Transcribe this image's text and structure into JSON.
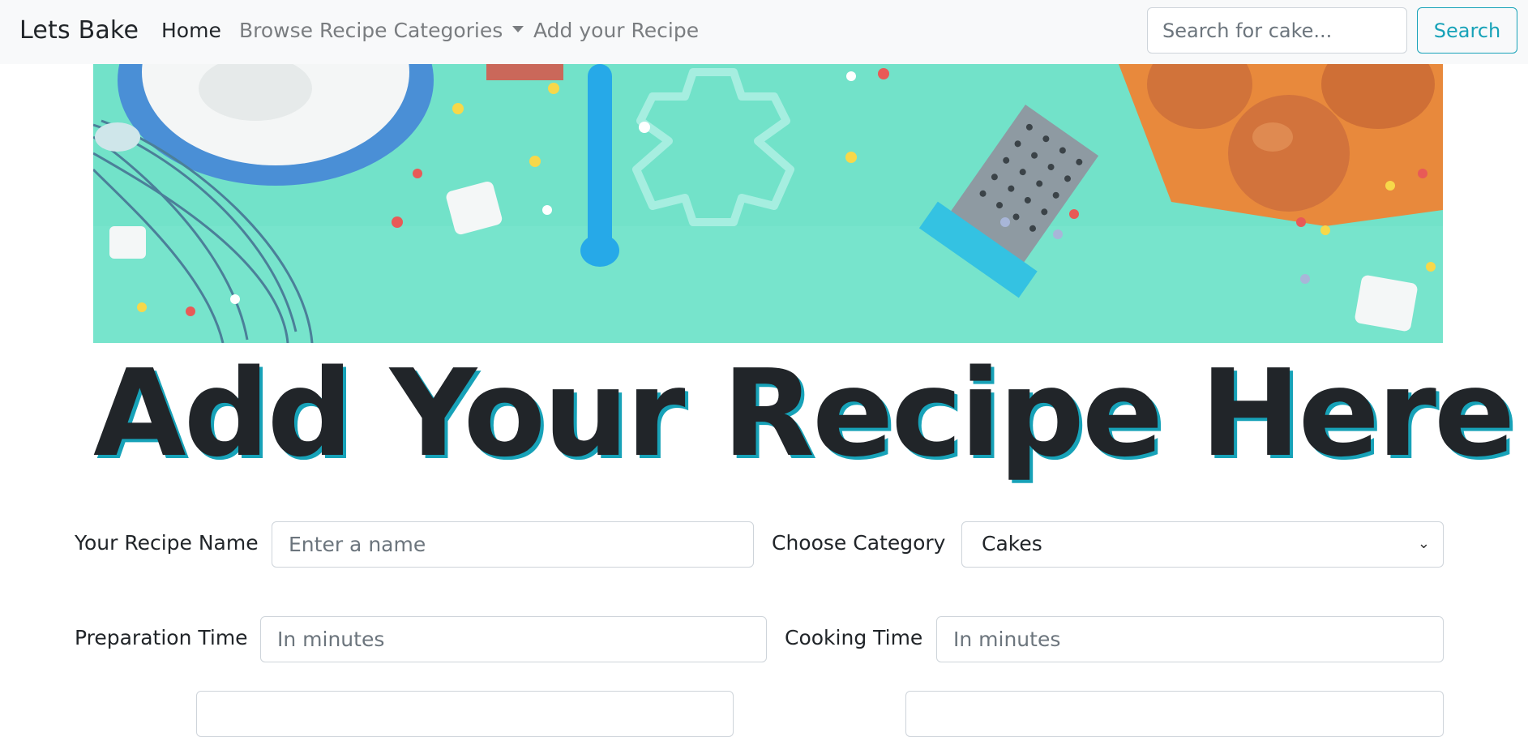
{
  "navbar": {
    "brand": "Lets Bake",
    "links": [
      {
        "label": "Home",
        "active": true
      },
      {
        "label": "Browse Recipe Categories",
        "dropdown": true
      },
      {
        "label": "Add your Recipe"
      }
    ],
    "search": {
      "placeholder": "Search for cake...",
      "button_label": "Search"
    }
  },
  "hero": {
    "background_color": "#6fe3c8"
  },
  "main": {
    "title": "Add Your Recipe Here",
    "form": {
      "recipe_name": {
        "label": "Your Recipe Name",
        "placeholder": "Enter a name"
      },
      "category": {
        "label": "Choose Category",
        "selected": "Cakes"
      },
      "prep_time": {
        "label": "Preparation Time",
        "placeholder": "In minutes"
      },
      "cook_time": {
        "label": "Cooking Time",
        "placeholder": "In minutes"
      }
    }
  },
  "colors": {
    "accent": "#17a2b8",
    "navbar_bg": "#f8f9fa"
  },
  "icons": {
    "category_dropdown": "chevron-down-icon",
    "nav_dropdown": "caret-down-icon"
  }
}
